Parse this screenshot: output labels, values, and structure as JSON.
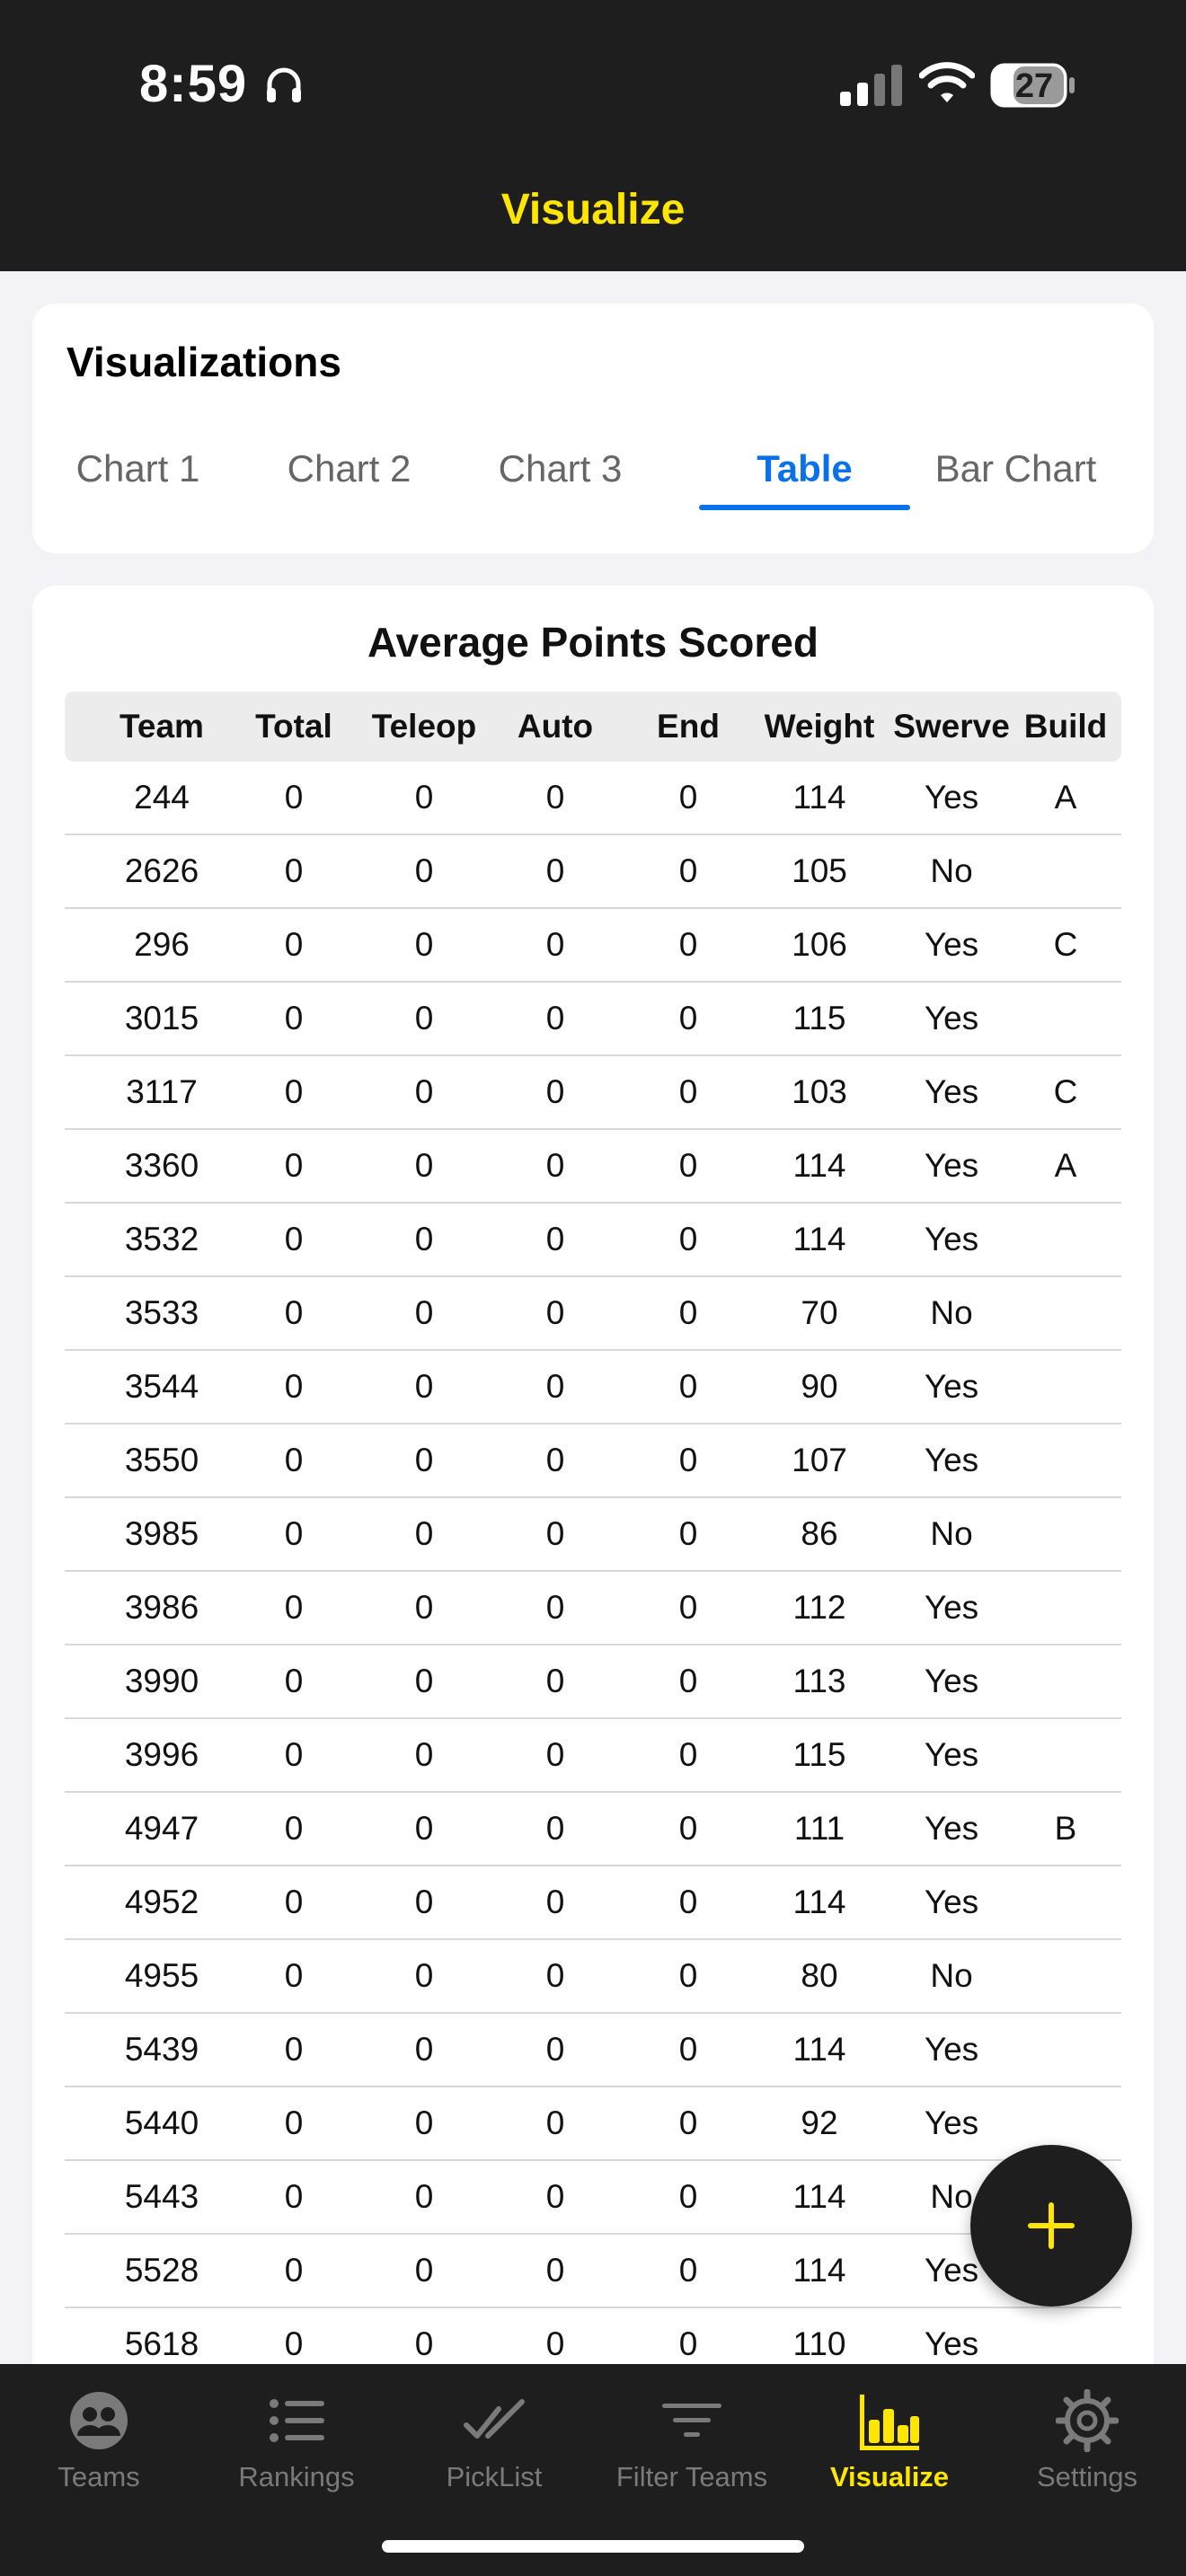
{
  "status_bar": {
    "time": "8:59",
    "battery": "27"
  },
  "header": {
    "title": "Visualize"
  },
  "visualizations": {
    "title": "Visualizations",
    "tabs": [
      {
        "label": "Chart 1"
      },
      {
        "label": "Chart 2"
      },
      {
        "label": "Chart 3"
      },
      {
        "label": "Table",
        "active": true
      },
      {
        "label": "Bar Chart"
      }
    ]
  },
  "table": {
    "title": "Average Points Scored",
    "columns": [
      "Team",
      "Total",
      "Teleop",
      "Auto",
      "End",
      "Weight",
      "Swerve",
      "Build"
    ],
    "rows": [
      [
        "244",
        "0",
        "0",
        "0",
        "0",
        "114",
        "Yes",
        "A"
      ],
      [
        "2626",
        "0",
        "0",
        "0",
        "0",
        "105",
        "No",
        ""
      ],
      [
        "296",
        "0",
        "0",
        "0",
        "0",
        "106",
        "Yes",
        "C"
      ],
      [
        "3015",
        "0",
        "0",
        "0",
        "0",
        "115",
        "Yes",
        ""
      ],
      [
        "3117",
        "0",
        "0",
        "0",
        "0",
        "103",
        "Yes",
        "C"
      ],
      [
        "3360",
        "0",
        "0",
        "0",
        "0",
        "114",
        "Yes",
        "A"
      ],
      [
        "3532",
        "0",
        "0",
        "0",
        "0",
        "114",
        "Yes",
        ""
      ],
      [
        "3533",
        "0",
        "0",
        "0",
        "0",
        "70",
        "No",
        ""
      ],
      [
        "3544",
        "0",
        "0",
        "0",
        "0",
        "90",
        "Yes",
        ""
      ],
      [
        "3550",
        "0",
        "0",
        "0",
        "0",
        "107",
        "Yes",
        ""
      ],
      [
        "3985",
        "0",
        "0",
        "0",
        "0",
        "86",
        "No",
        ""
      ],
      [
        "3986",
        "0",
        "0",
        "0",
        "0",
        "112",
        "Yes",
        ""
      ],
      [
        "3990",
        "0",
        "0",
        "0",
        "0",
        "113",
        "Yes",
        ""
      ],
      [
        "3996",
        "0",
        "0",
        "0",
        "0",
        "115",
        "Yes",
        ""
      ],
      [
        "4947",
        "0",
        "0",
        "0",
        "0",
        "111",
        "Yes",
        "B"
      ],
      [
        "4952",
        "0",
        "0",
        "0",
        "0",
        "114",
        "Yes",
        ""
      ],
      [
        "4955",
        "0",
        "0",
        "0",
        "0",
        "80",
        "No",
        ""
      ],
      [
        "5439",
        "0",
        "0",
        "0",
        "0",
        "114",
        "Yes",
        ""
      ],
      [
        "5440",
        "0",
        "0",
        "0",
        "0",
        "92",
        "Yes",
        ""
      ],
      [
        "5443",
        "0",
        "0",
        "0",
        "0",
        "114",
        "No",
        ""
      ],
      [
        "5528",
        "0",
        "0",
        "0",
        "0",
        "114",
        "Yes",
        ""
      ],
      [
        "5618",
        "0",
        "0",
        "0",
        "0",
        "110",
        "Yes",
        ""
      ]
    ]
  },
  "tab_bar": {
    "items": [
      {
        "label": "Teams",
        "icon": "teams-icon"
      },
      {
        "label": "Rankings",
        "icon": "list-icon"
      },
      {
        "label": "PickList",
        "icon": "checkmarks-icon"
      },
      {
        "label": "Filter Teams",
        "icon": "filter-icon"
      },
      {
        "label": "Visualize",
        "icon": "bar-chart-icon",
        "active": true
      },
      {
        "label": "Settings",
        "icon": "gear-icon"
      }
    ]
  },
  "colors": {
    "accent_yellow": "#ffe600",
    "tab_blue": "#0a72e8",
    "dark_bg": "#1e1e1e"
  }
}
